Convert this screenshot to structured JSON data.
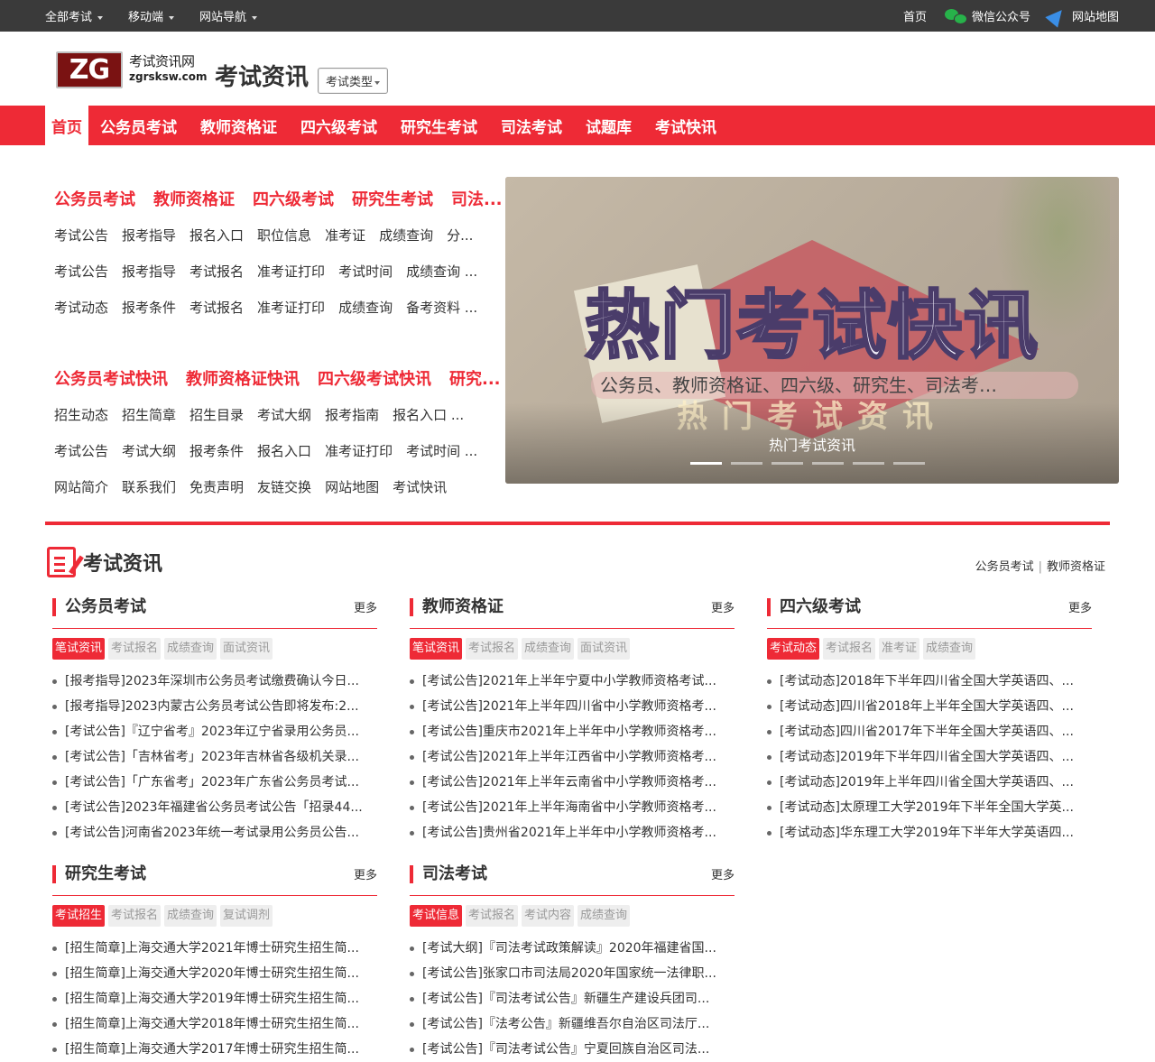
{
  "topbar": {
    "left": [
      "全部考试",
      "移动端",
      "网站导航"
    ],
    "home": "首页",
    "wechat": "微信公众号",
    "sitemap": "网站地图"
  },
  "header": {
    "logo_mark": "ZG",
    "logo_cn": "考试资讯网",
    "logo_en": "zgrsksw.com",
    "title": "考试资讯",
    "type_button": "考试类型"
  },
  "mainnav": [
    "首页",
    "公务员考试",
    "教师资格证",
    "四六级考试",
    "研究生考试",
    "司法考试",
    "试题库",
    "考试快讯"
  ],
  "hero_links": {
    "group1_title": [
      "公务员考试",
      "教师资格证",
      "四六级考试",
      "研究生考试",
      "司法..."
    ],
    "group1_rows": [
      [
        "考试公告",
        "报考指导",
        "报名入口",
        "职位信息",
        "准考证",
        "成绩查询",
        "分..."
      ],
      [
        "考试公告",
        "报考指导",
        "考试报名",
        "准考证打印",
        "考试时间",
        "成绩查询 ..."
      ],
      [
        "考试动态",
        "报考条件",
        "考试报名",
        "准考证打印",
        "成绩查询",
        "备考资料 ..."
      ]
    ],
    "group2_title": [
      "公务员考试快讯",
      "教师资格证快讯",
      "四六级考试快讯",
      "研究..."
    ],
    "group2_rows": [
      [
        "招生动态",
        "招生简章",
        "招生目录",
        "考试大纲",
        "报考指南",
        "报名入口 ..."
      ],
      [
        "考试公告",
        "考试大纲",
        "报考条件",
        "报名入口",
        "准考证打印",
        "考试时间 ..."
      ],
      [
        "网站简介",
        "联系我们",
        "免责声明",
        "友链交换",
        "网站地图",
        "考试快讯"
      ]
    ]
  },
  "banner": {
    "headline": "热门考试快讯",
    "subtitle": "公务员、教师资格证、四六级、研究生、司法考…",
    "ghost": "热门考试资讯",
    "caption": "热门考试资讯",
    "active_slide": 1,
    "slides": 6
  },
  "section": {
    "title": "考试资讯",
    "links": [
      "公务员考试",
      "教师资格证"
    ]
  },
  "columns": [
    {
      "title": "公务员考试",
      "more": "更多",
      "tabs": [
        "笔试资讯",
        "考试报名",
        "成绩查询",
        "面试资讯"
      ],
      "items": [
        "[报考指导]2023年深圳市公务员考试缴费确认今日...",
        "[报考指导]2023内蒙古公务员考试公告即将发布:2...",
        "[考试公告]『辽宁省考』2023年辽宁省录用公务员...",
        "[考试公告]「吉林省考」2023年吉林省各级机关录...",
        "[考试公告]「广东省考」2023年广东省公务员考试...",
        "[考试公告]2023年福建省公务员考试公告「招录44...",
        "[考试公告]河南省2023年统一考试录用公务员公告..."
      ]
    },
    {
      "title": "教师资格证",
      "more": "更多",
      "tabs": [
        "笔试资讯",
        "考试报名",
        "成绩查询",
        "面试资讯"
      ],
      "items": [
        "[考试公告]2021年上半年宁夏中小学教师资格考试...",
        "[考试公告]2021年上半年四川省中小学教师资格考...",
        "[考试公告]重庆市2021年上半年中小学教师资格考...",
        "[考试公告]2021年上半年江西省中小学教师资格考...",
        "[考试公告]2021年上半年云南省中小学教师资格考...",
        "[考试公告]2021年上半年海南省中小学教师资格考...",
        "[考试公告]贵州省2021年上半年中小学教师资格考..."
      ]
    },
    {
      "title": "四六级考试",
      "more": "更多",
      "tabs": [
        "考试动态",
        "考试报名",
        "准考证",
        "成绩查询"
      ],
      "items": [
        "[考试动态]2018年下半年四川省全国大学英语四、...",
        "[考试动态]四川省2018年上半年全国大学英语四、...",
        "[考试动态]四川省2017年下半年全国大学英语四、...",
        "[考试动态]2019年下半年四川省全国大学英语四、...",
        "[考试动态]2019年上半年四川省全国大学英语四、...",
        "[考试动态]太原理工大学2019年下半年全国大学英...",
        "[考试动态]华东理工大学2019年下半年大学英语四..."
      ]
    },
    {
      "title": "研究生考试",
      "more": "更多",
      "tabs": [
        "考试招生",
        "考试报名",
        "成绩查询",
        "复试调剂"
      ],
      "items": [
        "[招生简章]上海交通大学2021年博士研究生招生简...",
        "[招生简章]上海交通大学2020年博士研究生招生简...",
        "[招生简章]上海交通大学2019年博士研究生招生简...",
        "[招生简章]上海交通大学2018年博士研究生招生简...",
        "[招生简章]上海交通大学2017年博士研究生招生简..."
      ]
    },
    {
      "title": "司法考试",
      "more": "更多",
      "tabs": [
        "考试信息",
        "考试报名",
        "考试内容",
        "成绩查询"
      ],
      "items": [
        "[考试大纲]『司法考试政策解读』2020年福建省国...",
        "[考试公告]张家口市司法局2020年国家统一法律职...",
        "[考试公告]『司法考试公告』新疆生产建设兵团司...",
        "[考试公告]『法考公告』新疆维吾尔自治区司法厅...",
        "[考试公告]『司法考试公告』宁夏回族自治区司法..."
      ]
    }
  ]
}
